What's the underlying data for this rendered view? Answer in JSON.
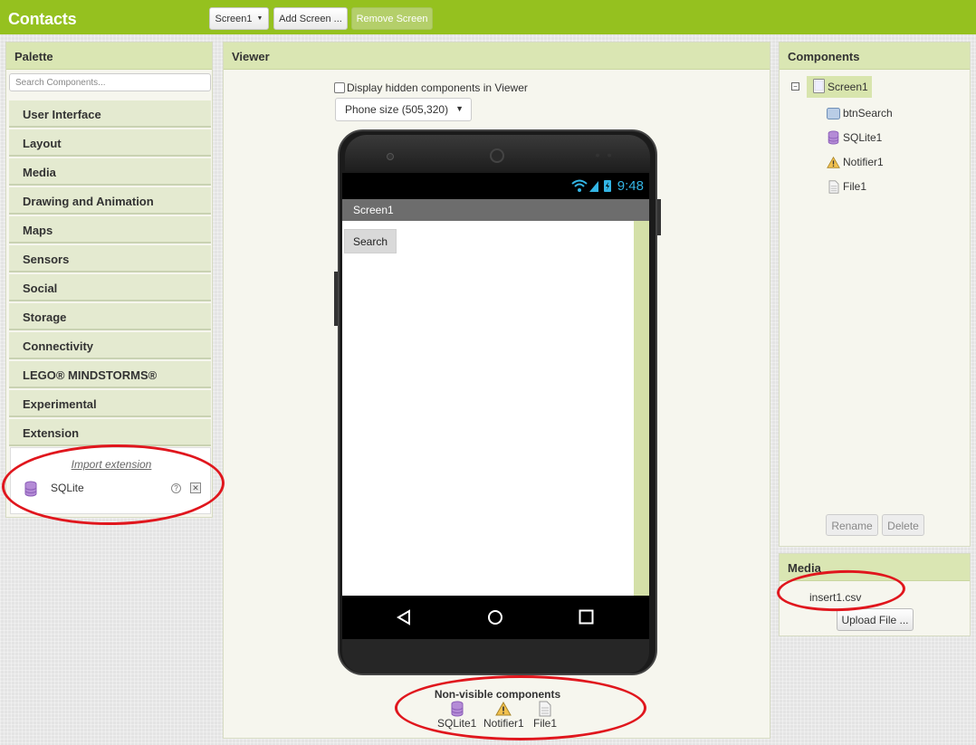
{
  "app": {
    "title": "Contacts"
  },
  "toolbar": {
    "screen_select": "Screen1",
    "add_screen": "Add Screen ...",
    "remove_screen": "Remove Screen"
  },
  "palette": {
    "title": "Palette",
    "search_placeholder": "Search Components...",
    "categories": [
      "User Interface",
      "Layout",
      "Media",
      "Drawing and Animation",
      "Maps",
      "Sensors",
      "Social",
      "Storage",
      "Connectivity",
      "LEGO® MINDSTORMS®",
      "Experimental",
      "Extension"
    ],
    "extension": {
      "import_label": "Import extension",
      "items": [
        {
          "label": "SQLite",
          "icon": "database-icon"
        }
      ],
      "help_glyph": "?"
    }
  },
  "viewer": {
    "title": "Viewer",
    "display_hidden_label": "Display hidden components in Viewer",
    "phone_size": "Phone size (505,320)",
    "phone": {
      "time": "9:48",
      "screen_title": "Screen1",
      "button_label": "Search"
    },
    "nonvisible": {
      "title": "Non-visible components",
      "items": [
        {
          "label": "SQLite1",
          "icon": "database-icon"
        },
        {
          "label": "Notifier1",
          "icon": "warning-icon"
        },
        {
          "label": "File1",
          "icon": "file-icon"
        }
      ]
    }
  },
  "components": {
    "title": "Components",
    "collapse_glyph": "−",
    "tree": {
      "root": {
        "label": "Screen1",
        "icon": "screen-icon"
      },
      "children": [
        {
          "label": "btnSearch",
          "icon": "button-icon"
        },
        {
          "label": "SQLite1",
          "icon": "database-icon"
        },
        {
          "label": "Notifier1",
          "icon": "warning-icon"
        },
        {
          "label": "File1",
          "icon": "file-icon"
        }
      ]
    },
    "rename_label": "Rename",
    "delete_label": "Delete"
  },
  "media": {
    "title": "Media",
    "files": [
      "insert1.csv"
    ],
    "upload_label": "Upload File ..."
  },
  "colors": {
    "topbar": "#95c11f",
    "panel_header": "#dae6b3",
    "annotation": "#e0161d",
    "status_blue": "#33b5e5"
  }
}
